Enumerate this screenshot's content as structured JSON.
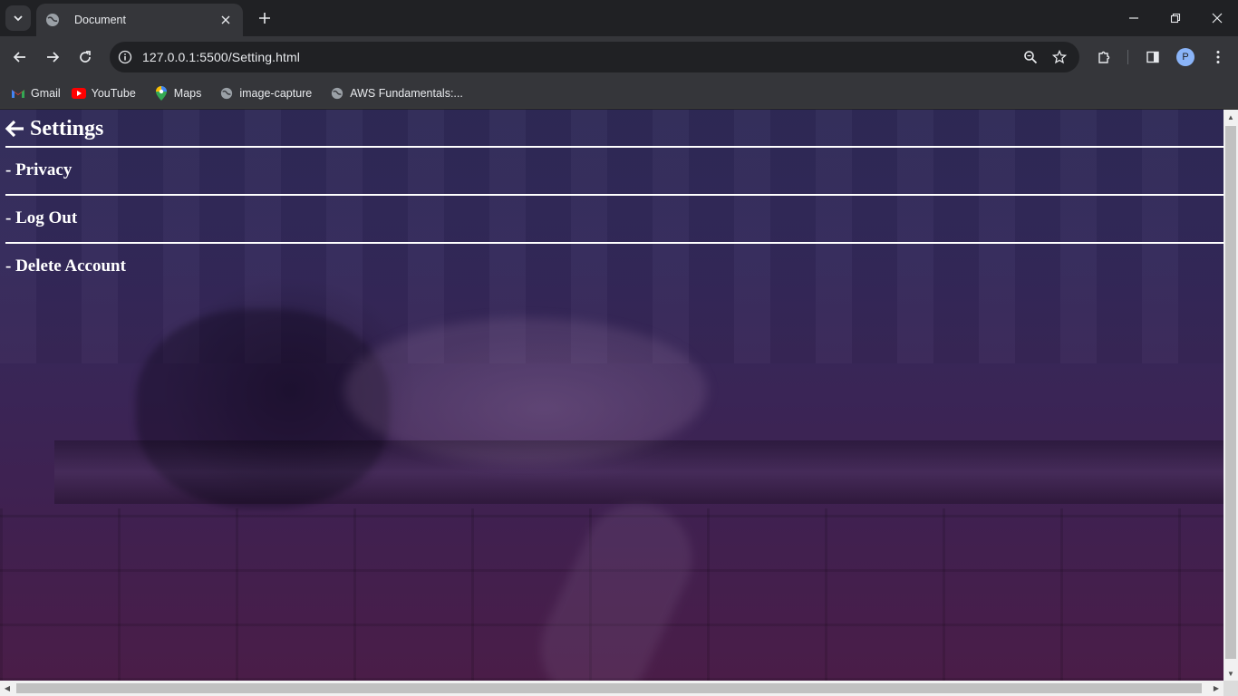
{
  "browser": {
    "tab": {
      "title": "Document"
    },
    "address_bar": {
      "url": "127.0.0.1:5500/Setting.html"
    },
    "profile_initial": "P",
    "bookmarks": [
      {
        "label": "Gmail",
        "icon": "gmail-icon"
      },
      {
        "label": "YouTube",
        "icon": "youtube-icon"
      },
      {
        "label": "Maps",
        "icon": "maps-icon"
      },
      {
        "label": "image-capture",
        "icon": "globe-icon"
      },
      {
        "label": "AWS Fundamentals:...",
        "icon": "globe-icon"
      }
    ]
  },
  "page": {
    "title": "Settings",
    "menu": [
      {
        "label": "- Privacy"
      },
      {
        "label": "- Log Out"
      },
      {
        "label": "- Delete Account"
      }
    ]
  },
  "colors": {
    "chrome_dark": "#202124",
    "chrome_toolbar": "#35363a",
    "page_overlay_top": "#2f2a57",
    "page_overlay_bottom": "#4a1d48",
    "text": "#ffffff"
  }
}
